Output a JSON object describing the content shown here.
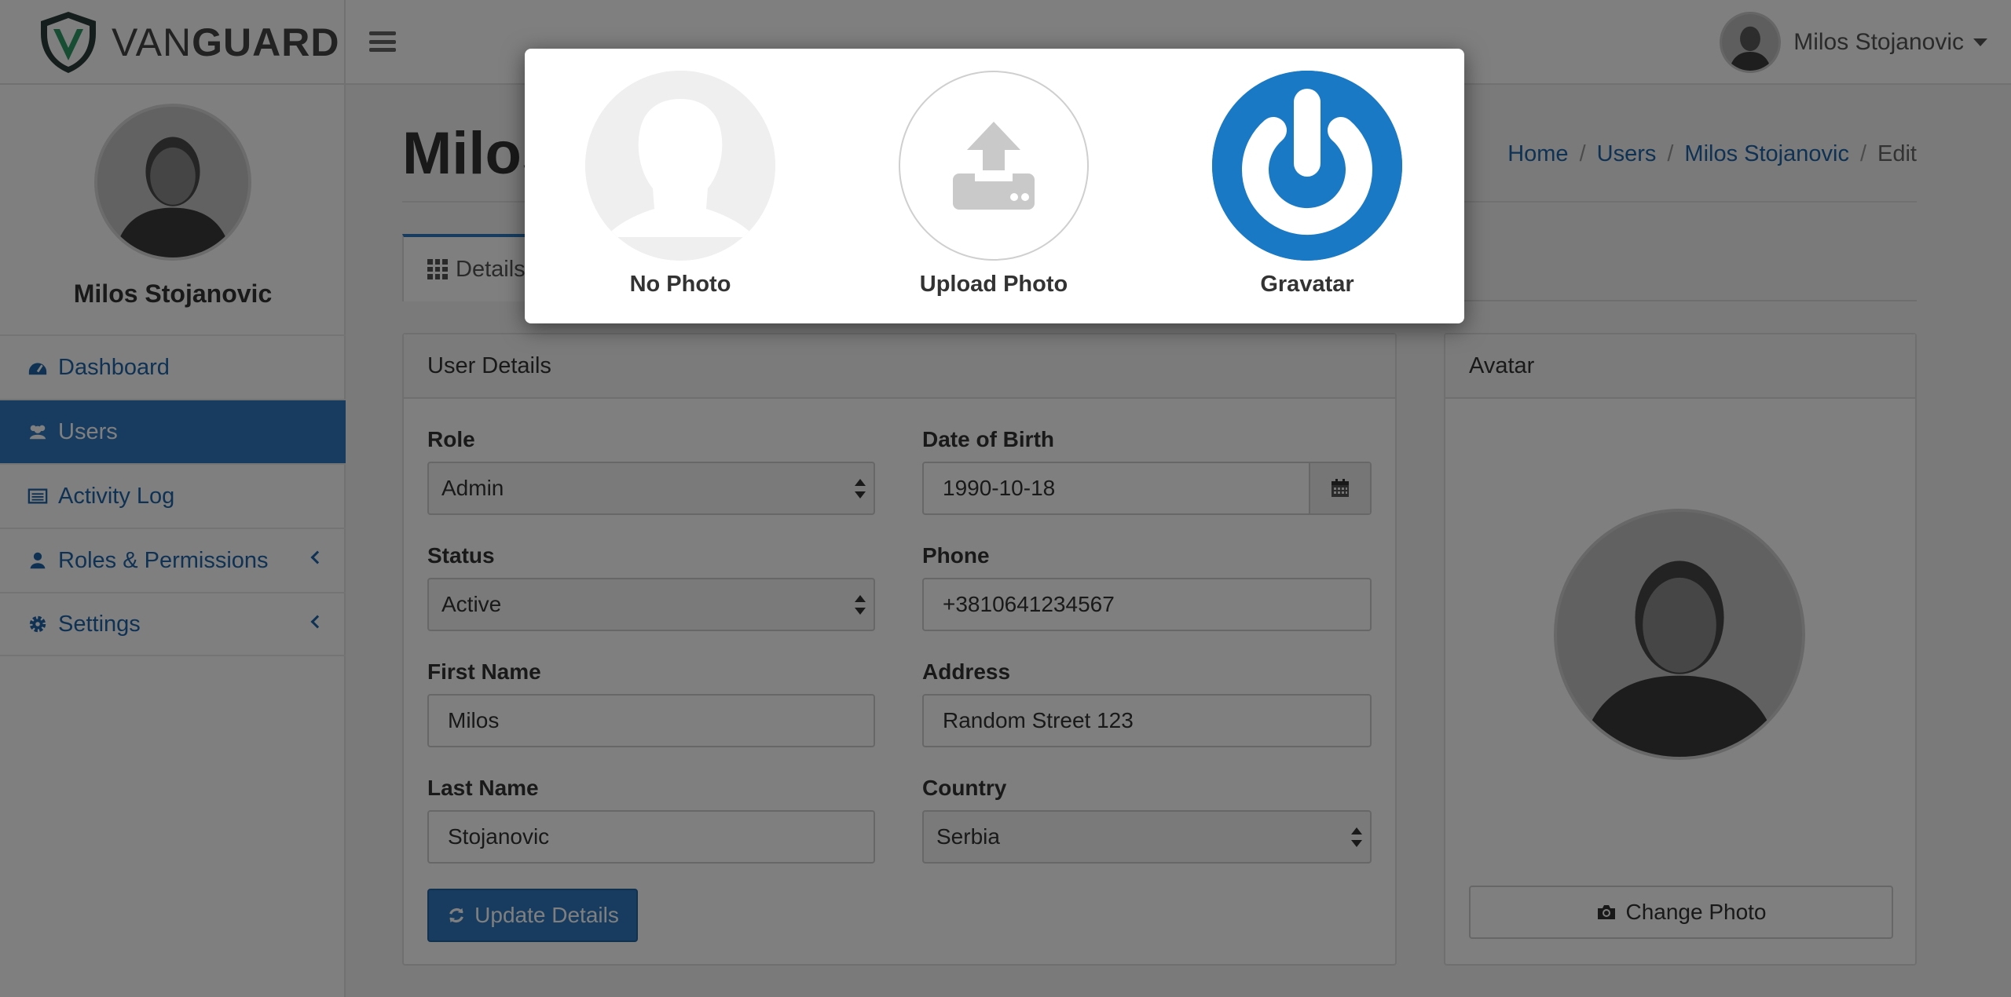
{
  "brand": {
    "light": "VAN",
    "bold": "GUARD"
  },
  "header": {
    "user_name": "Milos Stojanovic"
  },
  "sidebar": {
    "user_name": "Milos Stojanovic",
    "items": [
      {
        "label": "Dashboard",
        "icon": "dashboard-icon"
      },
      {
        "label": "Users",
        "icon": "users-icon",
        "active": true
      },
      {
        "label": "Activity Log",
        "icon": "list-icon"
      },
      {
        "label": "Roles & Permissions",
        "icon": "user-icon"
      },
      {
        "label": "Settings",
        "icon": "gear-icon"
      }
    ]
  },
  "page": {
    "title": "Milos Stojanovic",
    "breadcrumb": [
      "Home",
      "Users",
      "Milos Stojanovic",
      "Edit"
    ],
    "tab_label": "Details"
  },
  "details": {
    "heading": "User Details",
    "role_label": "Role",
    "role_value": "Admin",
    "status_label": "Status",
    "status_value": "Active",
    "first_name_label": "First Name",
    "first_name_value": "Milos",
    "last_name_label": "Last Name",
    "last_name_value": "Stojanovic",
    "dob_label": "Date of Birth",
    "dob_value": "1990-10-18",
    "phone_label": "Phone",
    "phone_value": "+3810641234567",
    "address_label": "Address",
    "address_value": "Random Street 123",
    "country_label": "Country",
    "country_value": "Serbia",
    "update_button": "Update Details"
  },
  "avatar_panel": {
    "heading": "Avatar",
    "change_button": "Change Photo"
  },
  "modal": {
    "options": [
      {
        "label": "No Photo"
      },
      {
        "label": "Upload Photo"
      },
      {
        "label": "Gravatar"
      }
    ]
  },
  "colors": {
    "accent": "#2f78bf",
    "link": "#1f64a8",
    "gravatar": "#1a79c4"
  }
}
